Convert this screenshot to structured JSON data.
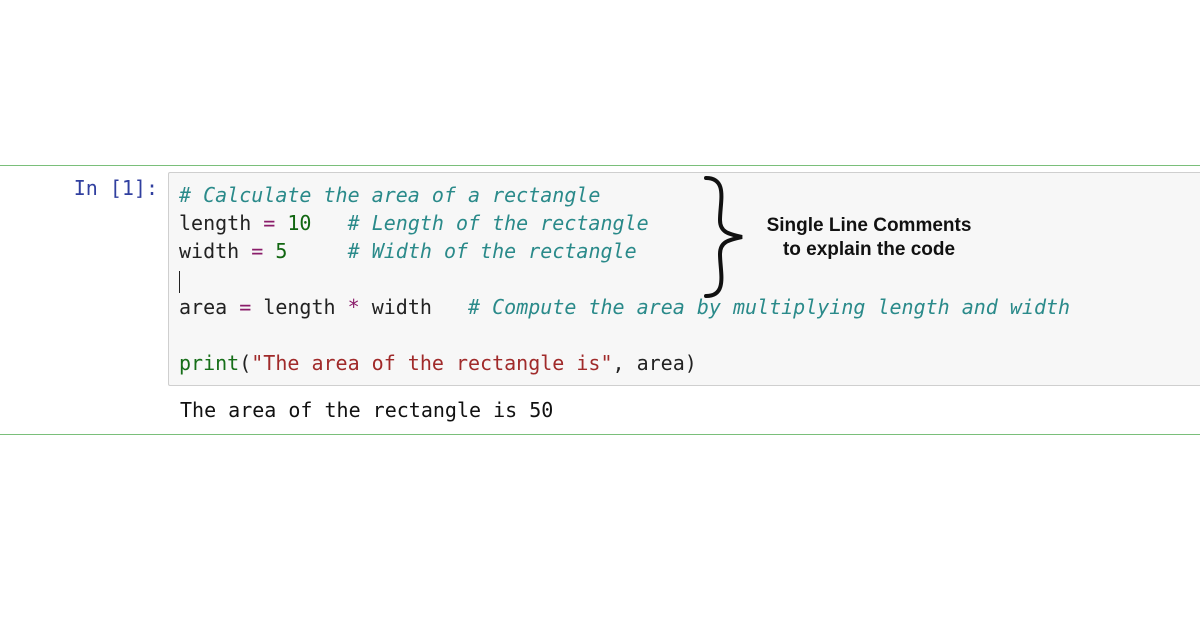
{
  "cell": {
    "prompt_label": "In [1]:",
    "code": {
      "line1_comment": "# Calculate the area of a rectangle",
      "line2_var": "length",
      "line2_eq": "=",
      "line2_val": "10",
      "line2_comment": "# Length of the rectangle",
      "line3_var": "width",
      "line3_eq": "=",
      "line3_val": "5",
      "line3_comment": "# Width of the rectangle",
      "line5_var": "area",
      "line5_eq": "=",
      "line5_expr_a": "length",
      "line5_op": "*",
      "line5_expr_b": "width",
      "line5_comment": "# Compute the area by multiplying length and width",
      "line7_fn": "print",
      "line7_open": "(",
      "line7_str": "\"The area of the rectangle is\"",
      "line7_comma": ",",
      "line7_arg": "area",
      "line7_close": ")"
    },
    "output_text": "The area of the rectangle is 50"
  },
  "annotation": {
    "line1": "Single Line Comments",
    "line2": "to explain the code"
  }
}
